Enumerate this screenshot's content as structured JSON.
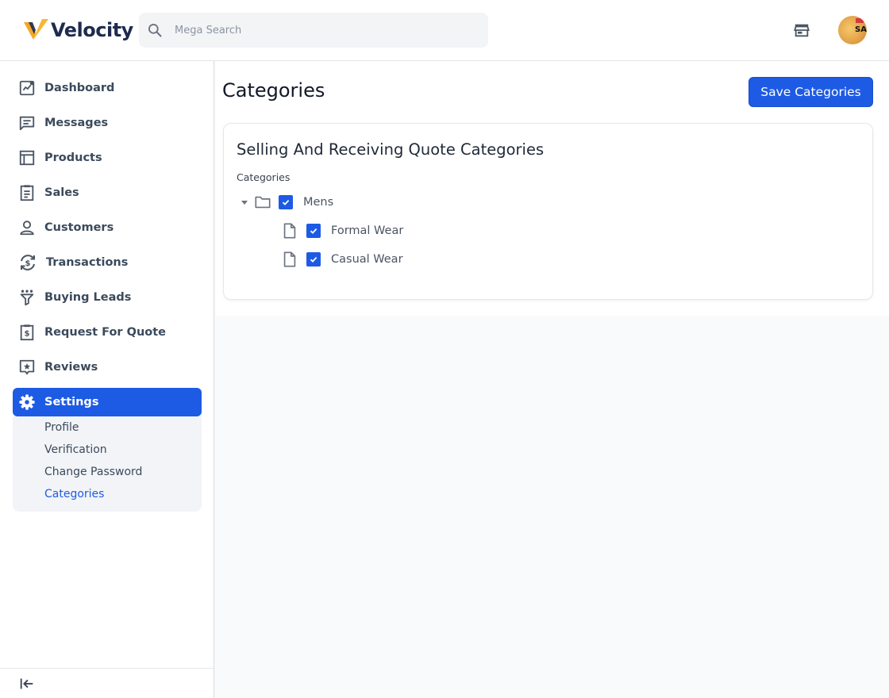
{
  "brand": {
    "name": "Velocity"
  },
  "search": {
    "placeholder": "Mega Search"
  },
  "header": {
    "avatar_text": "SAI"
  },
  "sidebar": {
    "items": [
      {
        "label": "Dashboard",
        "icon": "dashboard-icon"
      },
      {
        "label": "Messages",
        "icon": "messages-icon"
      },
      {
        "label": "Products",
        "icon": "products-icon"
      },
      {
        "label": "Sales",
        "icon": "sales-icon"
      },
      {
        "label": "Customers",
        "icon": "customers-icon"
      },
      {
        "label": "Transactions",
        "icon": "transactions-icon"
      },
      {
        "label": "Buying Leads",
        "icon": "buying-leads-icon"
      },
      {
        "label": "Request For Quote",
        "icon": "request-quote-icon"
      },
      {
        "label": "Reviews",
        "icon": "reviews-icon"
      },
      {
        "label": "Settings",
        "icon": "gear-icon",
        "active": true
      }
    ],
    "settings_submenu": [
      {
        "label": "Profile"
      },
      {
        "label": "Verification"
      },
      {
        "label": "Change Password"
      },
      {
        "label": "Categories",
        "active": true
      }
    ]
  },
  "page": {
    "title": "Categories",
    "save_label": "Save Categories"
  },
  "card": {
    "title": "Selling And Receiving Quote Categories",
    "field_label": "Categories",
    "tree": {
      "label": "Mens",
      "checked": true,
      "expanded": true,
      "children": [
        {
          "label": "Formal Wear",
          "checked": true
        },
        {
          "label": "Casual Wear",
          "checked": true
        }
      ]
    }
  },
  "colors": {
    "accent": "#1d5be5",
    "brand_orange": "#f5a623",
    "brand_navy": "#1e2b4d",
    "nav_text": "#3b4a5c"
  }
}
